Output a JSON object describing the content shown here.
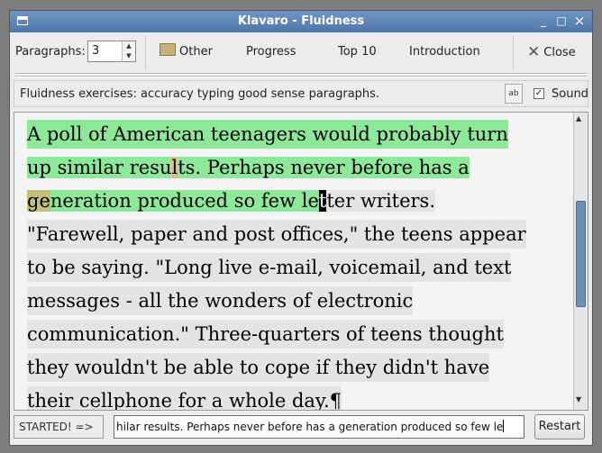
{
  "window": {
    "title": "Klavaro - Fluidness",
    "minimize": "_",
    "maximize": "□",
    "close": "×"
  },
  "toolbar": {
    "paragraphs_label": "Paragraphs:",
    "paragraphs_value": "3",
    "other": "Other",
    "progress": "Progress",
    "top10": "Top 10",
    "introduction": "Introduction",
    "close": "Close"
  },
  "info": {
    "text": "Fluidness exercises: accuracy typing good sense paragraphs.",
    "font_button": "ab",
    "sound_label": "Sound",
    "sound_checked": true
  },
  "text": {
    "line1": "A poll of American teenagers would probably turn",
    "line2a": "up similar resu",
    "line2b": "l",
    "line2c": "ts. Perhaps never before has a",
    "line3a": "g",
    "line3b": "e",
    "line3c": "neration produced so few le",
    "line3d": "t",
    "line3e": "ter writers.",
    "line4": "\"Farewell, paper and post offices,\" the teens appear",
    "line5": "to be saying. \"Long live e-mail, voicemail, and text",
    "line6": "messages - all the wonders of electronic",
    "line7": "communication.\" Three-quarters of teens thought",
    "line8": "they wouldn't be able to cope if they didn't have",
    "line9": "their cellphone for a whole day.¶"
  },
  "bottom": {
    "status": "STARTED! =>",
    "typed": "hilar results. Perhaps never before has a generation produced so few le",
    "restart": "Restart"
  },
  "colors": {
    "typed_ok": "#8de89a",
    "untyped": "#e4e4e4",
    "error": "#c2c07a",
    "titlebar": "#5a82b3"
  }
}
